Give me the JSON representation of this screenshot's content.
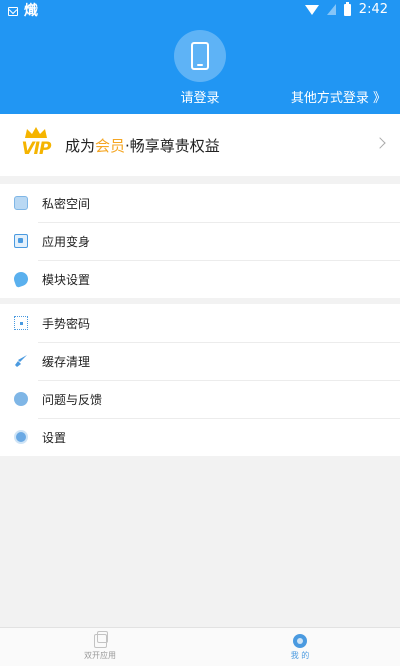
{
  "status_bar": {
    "app_glyph": "熾",
    "time": "2:42"
  },
  "header": {
    "login_label": "请登录",
    "other_login_label": "其他方式登录 》"
  },
  "vip": {
    "badge_text": "VIP",
    "title_prefix": "成为",
    "title_accent": "会员",
    "title_suffix": "·畅享尊贵权益"
  },
  "menu_group_1": [
    {
      "label": "私密空间",
      "icon": "privacy-space-icon"
    },
    {
      "label": "应用变身",
      "icon": "app-disguise-icon"
    },
    {
      "label": "模块设置",
      "icon": "module-settings-icon"
    }
  ],
  "menu_group_2": [
    {
      "label": "手势密码",
      "icon": "gesture-password-icon"
    },
    {
      "label": "缓存清理",
      "icon": "cache-clean-icon"
    },
    {
      "label": "问题与反馈",
      "icon": "feedback-icon"
    },
    {
      "label": "设置",
      "icon": "settings-icon"
    }
  ],
  "bottom_nav": {
    "items": [
      {
        "label": "双开应用",
        "active": false
      },
      {
        "label": "我 的",
        "active": true
      }
    ]
  },
  "colors": {
    "header_blue": "#2196f3",
    "vip_gold": "#f5a623",
    "accent_blue": "#4a9ae0"
  }
}
